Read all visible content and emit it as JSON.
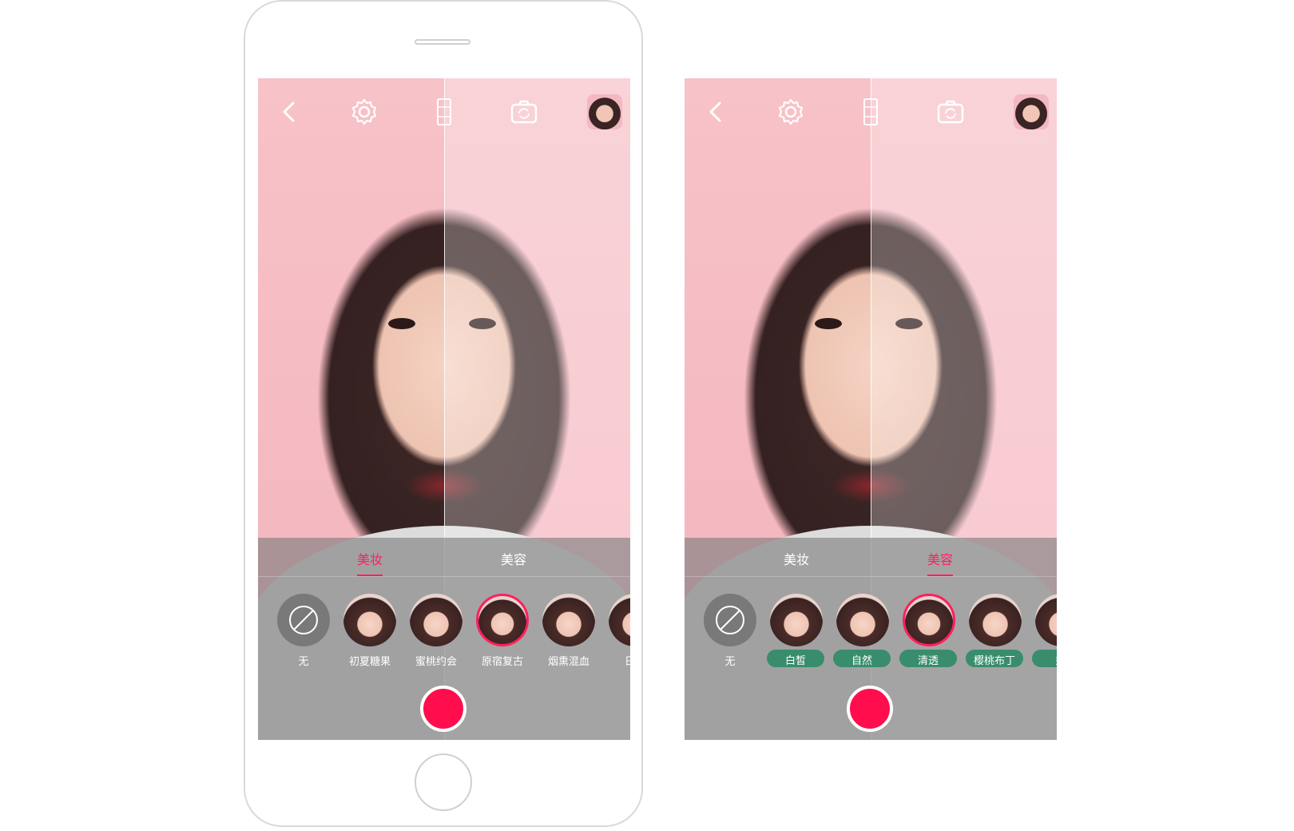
{
  "screen1": {
    "tabs": [
      {
        "label": "美妆",
        "active": true
      },
      {
        "label": "美容",
        "active": false
      }
    ],
    "styles": [
      {
        "label": "无",
        "type": "none"
      },
      {
        "label": "初夏糖果"
      },
      {
        "label": "蜜桃约会"
      },
      {
        "label": "原宿复古",
        "selected": true
      },
      {
        "label": "烟熏混血"
      },
      {
        "label": "日系"
      }
    ]
  },
  "screen2": {
    "tabs": [
      {
        "label": "美妆",
        "active": false
      },
      {
        "label": "美容",
        "active": true
      }
    ],
    "styles": [
      {
        "label": "无",
        "type": "none"
      },
      {
        "label": "白皙"
      },
      {
        "label": "自然"
      },
      {
        "label": "清透",
        "selected": true
      },
      {
        "label": "樱桃布丁"
      },
      {
        "label": "奶"
      }
    ]
  },
  "colors": {
    "accent": "#ff1f5e",
    "record": "#ff0d4d",
    "beauty_label_pill": "#2e8b66"
  },
  "icons": [
    "back-icon",
    "settings-icon",
    "aspect-ratio-icon",
    "camera-flip-icon",
    "no-effect-icon"
  ]
}
